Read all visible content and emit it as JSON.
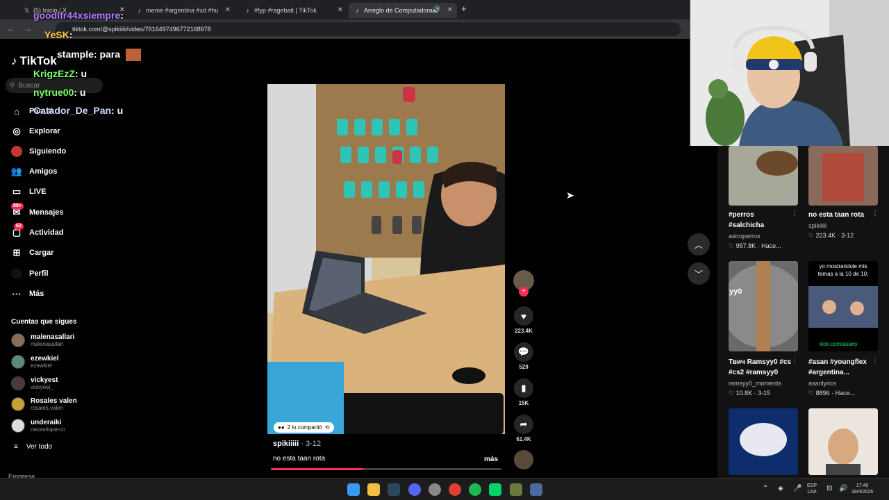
{
  "browser": {
    "tabs": [
      {
        "label": "(5) Inicio / X"
      },
      {
        "label": "meme #argentina #xd #hu"
      },
      {
        "label": "#fyp #ragebait | TikTok"
      },
      {
        "label": "Arreglo de Computadora D"
      }
    ],
    "url": "tiktok.com/@spikiiiii/video/7616497496772168978"
  },
  "chat": [
    {
      "user": "goodlfr44xsiempre",
      "suffix": ":",
      "color": "#b57cff"
    },
    {
      "user": "YeSK",
      "suffix": ":",
      "color": "#ffd24a"
    },
    {
      "user": "stample",
      "suffix": ": para",
      "color": "#ffffff"
    },
    {
      "user": "KrigzEzZ",
      "suffix": ": u",
      "color": "#7cff6b"
    },
    {
      "user": "nytrue00",
      "suffix": ": u",
      "color": "#7cff6b"
    },
    {
      "user": "Catador_De_Pan",
      "suffix": ": u",
      "color": "#cfd8ff"
    }
  ],
  "sidebar": {
    "logo": "TikTok",
    "search_placeholder": "Buscar",
    "items": [
      {
        "label": "Para ti",
        "icon": "home-icon"
      },
      {
        "label": "Explorar",
        "icon": "compass-icon"
      },
      {
        "label": "Siguiendo",
        "icon": "following-icon"
      },
      {
        "label": "Amigos",
        "icon": "friends-icon"
      },
      {
        "label": "LIVE",
        "icon": "live-icon"
      },
      {
        "label": "Mensajes",
        "icon": "messages-icon",
        "badge": "99+"
      },
      {
        "label": "Actividad",
        "icon": "activity-icon",
        "badge": "62"
      },
      {
        "label": "Cargar",
        "icon": "upload-icon"
      },
      {
        "label": "Perfil",
        "icon": "profile-icon"
      },
      {
        "label": "Más",
        "icon": "more-icon"
      }
    ],
    "following_title": "Cuentas que sigues",
    "following": [
      {
        "name": "malenasallari",
        "handle": "malenasallari"
      },
      {
        "name": "ezewkiel",
        "handle": "ezewkiel"
      },
      {
        "name": "vickyest",
        "handle": "vickyest_"
      },
      {
        "name": "Rosales valen",
        "handle": "rosales.valen"
      },
      {
        "name": "underaiki",
        "handle": "necesitoperco"
      }
    ],
    "see_all": "Ver todo",
    "company": "Empresa"
  },
  "video": {
    "shared_text": "2 lo compartió",
    "author": "spikiiiii",
    "date": "3-12",
    "caption": "no esta taan rota",
    "more_label": "más",
    "progress": 0.4,
    "likes": "223.4K",
    "comments": "529",
    "saves": "15K",
    "shares": "61.4K"
  },
  "grid": [
    {
      "title": "#perros #salchicha",
      "author": "astroperros",
      "stats": "957.8K · Hace..."
    },
    {
      "title": "no esta taan rota",
      "author": "spikiiiii",
      "stats": "223.4K · 3-12"
    },
    {
      "title": "Твич Ramsyy0 #cs #cs2 #ramsyy0",
      "author": "ramsyy0_moments",
      "stats": "10.8K · 3-15",
      "overlay": "yy0"
    },
    {
      "title": "#asan #youngflex #argentina...",
      "author": "asanlyrics",
      "stats": "8896 · Hace...",
      "overlay": "yo mostrandole mis temas a la 10 de 10:",
      "link": "kick.com/asany"
    }
  ],
  "taskbar": {
    "lang": "ESP",
    "lang2": "LAA",
    "time": "17:40",
    "date": "18/4/2026"
  }
}
